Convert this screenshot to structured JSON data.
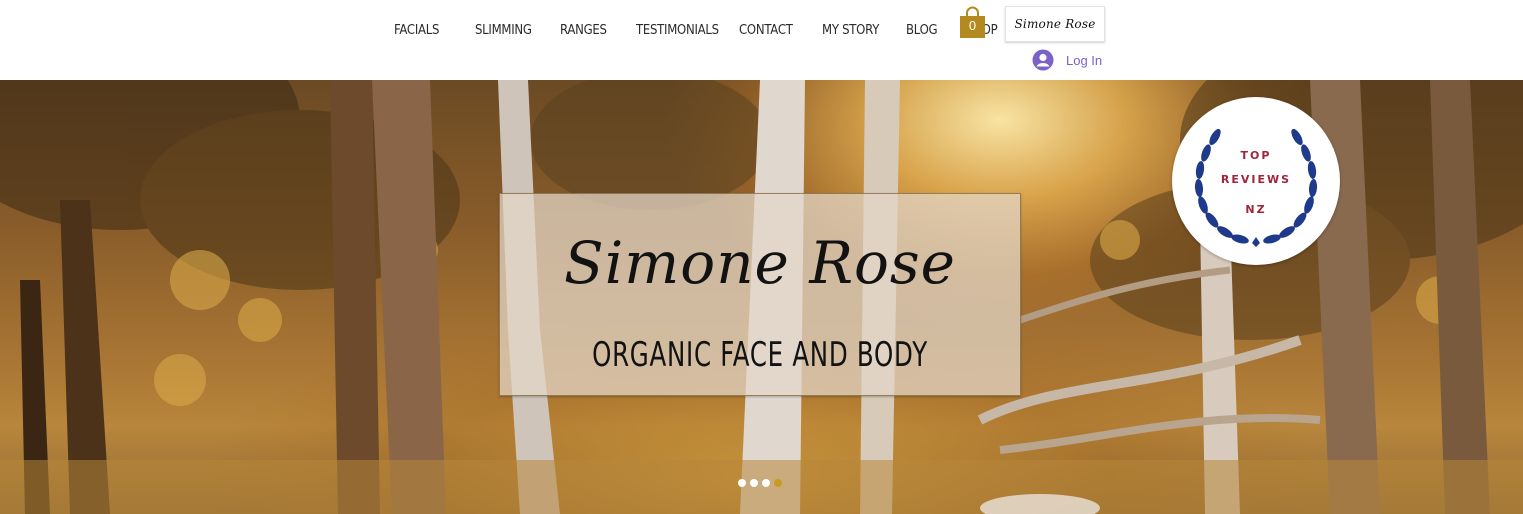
{
  "nav": {
    "items": [
      "FACIALS",
      "SLIMMING",
      "RANGES",
      "TESTIMONIALS",
      "CONTACT",
      "MY STORY",
      "BLOG",
      "SHOP"
    ]
  },
  "cart": {
    "count": "0",
    "icon": "shopping-bag-icon",
    "color": "#b48a1e"
  },
  "logo": {
    "text": "Simone Rose"
  },
  "login": {
    "label": "Log In",
    "icon": "user-avatar-icon",
    "color": "#7b62c9"
  },
  "hero": {
    "brand_name": "Simone Rose",
    "tagline": "ORGANIC FACE AND BODY"
  },
  "badge": {
    "line1": "TOP",
    "line2": "REVIEWS",
    "line3": "NZ",
    "wreath_color": "#1f3a8a",
    "text_color": "#a0243a"
  },
  "slideshow": {
    "total": 4,
    "active": 4,
    "active_color": "#c89b22"
  }
}
